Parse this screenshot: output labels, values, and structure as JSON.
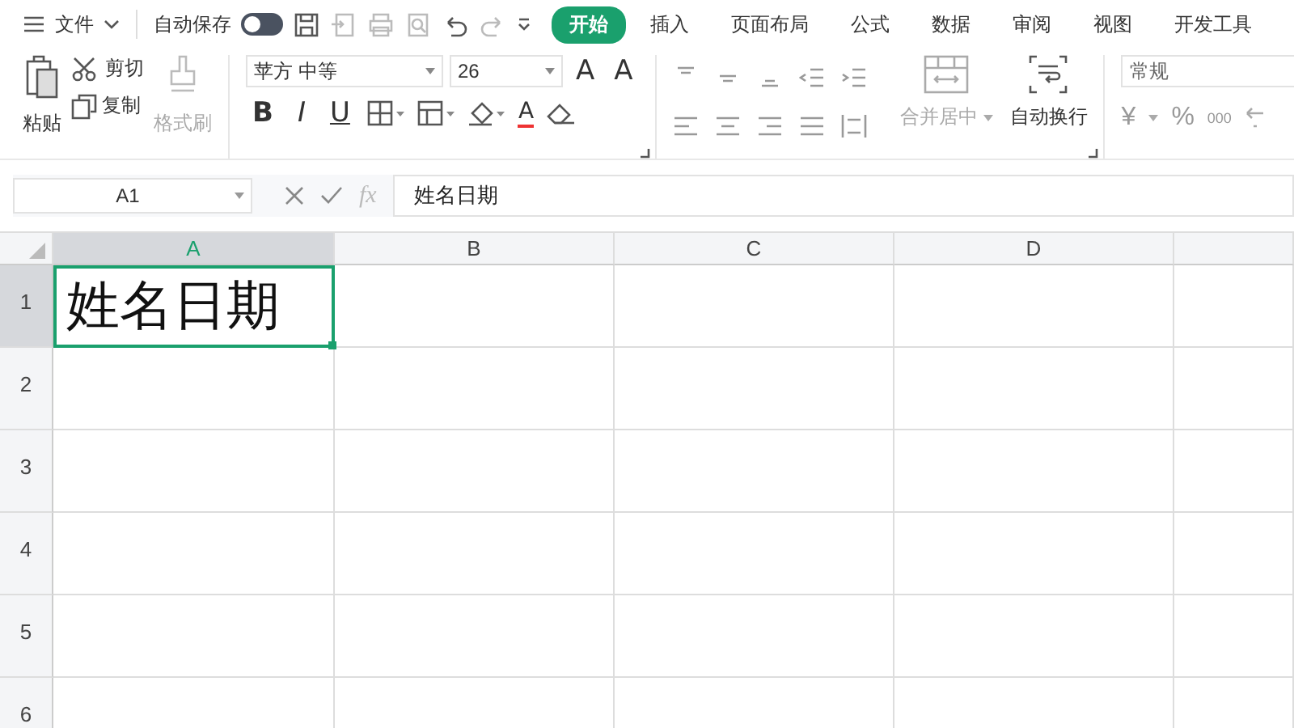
{
  "menu": {
    "label": "文件"
  },
  "autosave": {
    "label": "自动保存",
    "on": false
  },
  "tabs": [
    {
      "label": "开始",
      "selected": true
    },
    {
      "label": "插入",
      "selected": false
    },
    {
      "label": "页面布局",
      "selected": false
    },
    {
      "label": "公式",
      "selected": false
    },
    {
      "label": "数据",
      "selected": false
    },
    {
      "label": "审阅",
      "selected": false
    },
    {
      "label": "视图",
      "selected": false
    },
    {
      "label": "开发工具",
      "selected": false
    }
  ],
  "clipboard": {
    "paste": "粘贴",
    "cut": "剪切",
    "copy": "复制",
    "format_painter": {
      "label": "格式刷",
      "disabled": true
    }
  },
  "font": {
    "name": "苹方 中等",
    "size": "26",
    "grow": "A",
    "shrink": "A",
    "bold": "B",
    "italic": "I",
    "underline": "U",
    "color_letter": "A"
  },
  "alignment": {
    "merge": {
      "label": "合并居中",
      "disabled": true
    },
    "wrap": {
      "label": "自动换行",
      "disabled": false
    }
  },
  "number": {
    "format": "常规",
    "currency": "¥",
    "percent": "%",
    "thousands": "000"
  },
  "formula_bar": {
    "name_box": "A1",
    "fx": "fx",
    "content": "姓名日期"
  },
  "sheet": {
    "columns": [
      {
        "label": "A",
        "selected": true
      },
      {
        "label": "B",
        "selected": false
      },
      {
        "label": "C",
        "selected": false
      },
      {
        "label": "D",
        "selected": false
      }
    ],
    "rows": [
      {
        "label": "1",
        "selected": true,
        "cells": [
          "姓名日期",
          "",
          "",
          ""
        ]
      },
      {
        "label": "2",
        "selected": false,
        "cells": [
          "",
          "",
          "",
          ""
        ]
      },
      {
        "label": "3",
        "selected": false,
        "cells": [
          "",
          "",
          "",
          ""
        ]
      },
      {
        "label": "4",
        "selected": false,
        "cells": [
          "",
          "",
          "",
          ""
        ]
      },
      {
        "label": "5",
        "selected": false,
        "cells": [
          "",
          "",
          "",
          ""
        ]
      },
      {
        "label": "6",
        "selected": false,
        "cells": [
          "",
          "",
          "",
          ""
        ]
      }
    ]
  }
}
